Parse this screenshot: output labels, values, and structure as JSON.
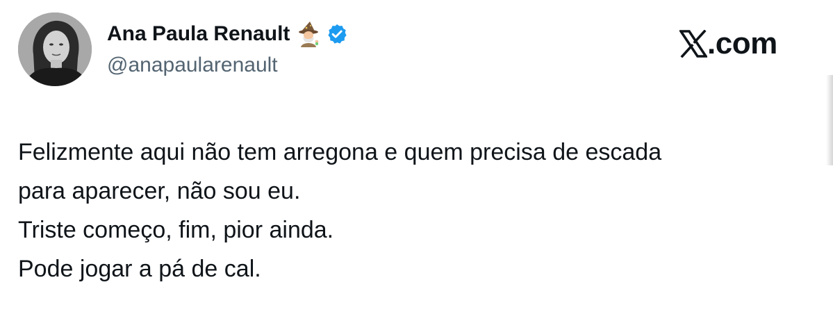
{
  "author": {
    "display_name": "Ana Paula Renault",
    "handle": "@anapaularenault",
    "name_emoji": "mage-emoji",
    "verified": true,
    "verified_color": "#1d9bf0"
  },
  "brand": {
    "text": ".com",
    "logo_icon": "x-logo-icon"
  },
  "tweet": {
    "lines": [
      "Felizmente aqui não tem arregona e quem precisa de escada",
      "para aparecer, não sou eu.",
      "Triste começo, fim, pior ainda.",
      "Pode jogar a pá de cal."
    ]
  },
  "colors": {
    "text_primary": "#0f1419",
    "text_secondary": "#536471",
    "background": "#ffffff"
  }
}
